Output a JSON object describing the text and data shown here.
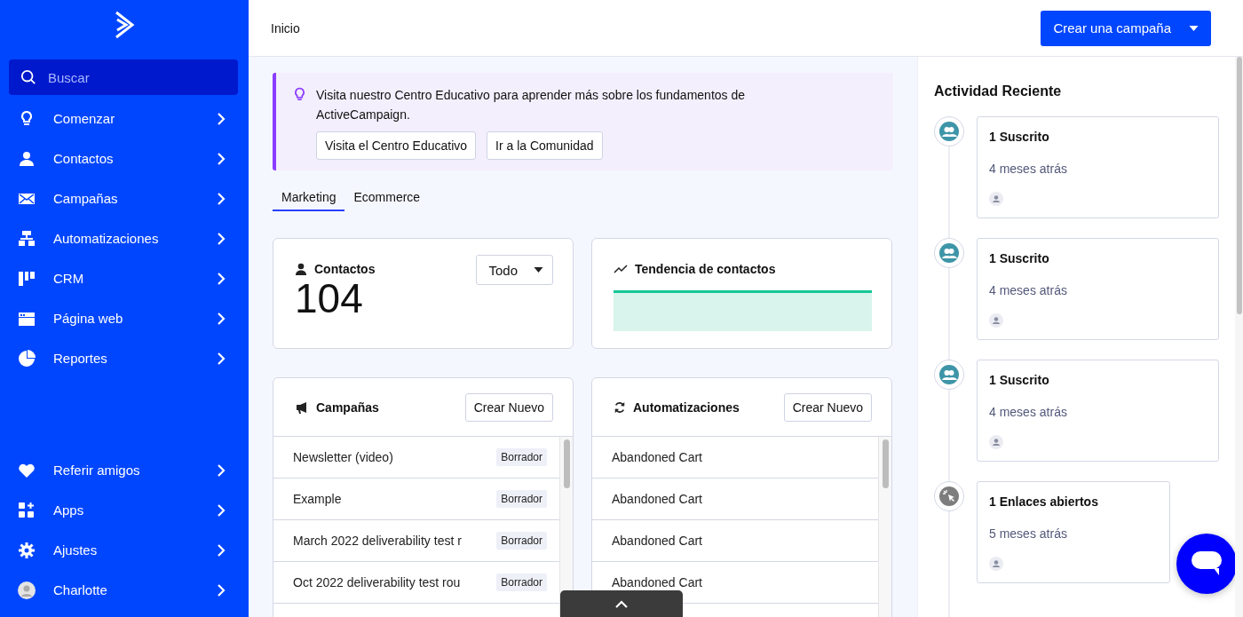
{
  "sidebar": {
    "search": {
      "placeholder": "Buscar"
    },
    "items": [
      {
        "label": "Comenzar"
      },
      {
        "label": "Contactos"
      },
      {
        "label": "Campañas"
      },
      {
        "label": "Automatizaciones"
      },
      {
        "label": "CRM"
      },
      {
        "label": "Página web"
      },
      {
        "label": "Reportes"
      }
    ],
    "bottom_items": [
      {
        "label": "Referir amigos"
      },
      {
        "label": "Apps"
      },
      {
        "label": "Ajustes"
      },
      {
        "label": "Charlotte"
      }
    ]
  },
  "header": {
    "title": "Inicio",
    "create_button": "Crear una campaña"
  },
  "notice": {
    "text": "Visita nuestro Centro Educativo para aprender más sobre los fundamentos de ActiveCampaign.",
    "buttons": [
      "Visita el Centro Educativo",
      "Ir a la Comunidad"
    ]
  },
  "tabs": [
    {
      "label": "Marketing",
      "selected": true
    },
    {
      "label": "Ecommerce",
      "selected": false
    }
  ],
  "contacts_card": {
    "title": "Contactos",
    "filter": "Todo",
    "count": "104"
  },
  "trend_card": {
    "title": "Tendencia de contactos"
  },
  "campaigns": {
    "title": "Campañas",
    "button": "Crear Nuevo",
    "rows": [
      {
        "name": "Newsletter (video)",
        "status": "Borrador"
      },
      {
        "name": "Example",
        "status": "Borrador"
      },
      {
        "name": "March 2022 deliverability test r",
        "status": "Borrador"
      },
      {
        "name": "Oct 2022 deliverability test rou",
        "status": "Borrador"
      }
    ]
  },
  "automations": {
    "title": "Automatizaciones",
    "button": "Crear Nuevo",
    "rows": [
      "Abandoned Cart",
      "Abandoned Cart",
      "Abandoned Cart",
      "Abandoned Cart"
    ]
  },
  "activity": {
    "title": "Actividad Reciente",
    "items": [
      {
        "kind": "subscribe",
        "title": "1 Suscrito",
        "time": "4 meses atrás"
      },
      {
        "kind": "subscribe",
        "title": "1 Suscrito",
        "time": "4 meses atrás"
      },
      {
        "kind": "subscribe",
        "title": "1 Suscrito",
        "time": "4 meses atrás"
      },
      {
        "kind": "click",
        "title": "1 Enlaces abiertos",
        "time": "5 meses atrás"
      }
    ]
  }
}
